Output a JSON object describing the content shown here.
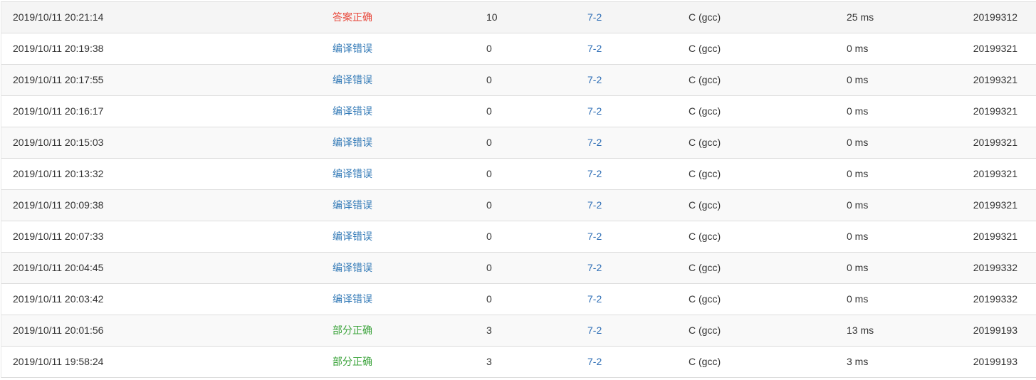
{
  "submissions": [
    {
      "time": "2019/10/11 20:21:14",
      "status": "答案正确",
      "status_type": "ac",
      "score": "10",
      "problem": "7-2",
      "compiler": "C (gcc)",
      "time_used": "25 ms",
      "user": "20199312"
    },
    {
      "time": "2019/10/11 20:19:38",
      "status": "编译错误",
      "status_type": "ce",
      "score": "0",
      "problem": "7-2",
      "compiler": "C (gcc)",
      "time_used": "0 ms",
      "user": "20199321"
    },
    {
      "time": "2019/10/11 20:17:55",
      "status": "编译错误",
      "status_type": "ce",
      "score": "0",
      "problem": "7-2",
      "compiler": "C (gcc)",
      "time_used": "0 ms",
      "user": "20199321"
    },
    {
      "time": "2019/10/11 20:16:17",
      "status": "编译错误",
      "status_type": "ce",
      "score": "0",
      "problem": "7-2",
      "compiler": "C (gcc)",
      "time_used": "0 ms",
      "user": "20199321"
    },
    {
      "time": "2019/10/11 20:15:03",
      "status": "编译错误",
      "status_type": "ce",
      "score": "0",
      "problem": "7-2",
      "compiler": "C (gcc)",
      "time_used": "0 ms",
      "user": "20199321"
    },
    {
      "time": "2019/10/11 20:13:32",
      "status": "编译错误",
      "status_type": "ce",
      "score": "0",
      "problem": "7-2",
      "compiler": "C (gcc)",
      "time_used": "0 ms",
      "user": "20199321"
    },
    {
      "time": "2019/10/11 20:09:38",
      "status": "编译错误",
      "status_type": "ce",
      "score": "0",
      "problem": "7-2",
      "compiler": "C (gcc)",
      "time_used": "0 ms",
      "user": "20199321"
    },
    {
      "time": "2019/10/11 20:07:33",
      "status": "编译错误",
      "status_type": "ce",
      "score": "0",
      "problem": "7-2",
      "compiler": "C (gcc)",
      "time_used": "0 ms",
      "user": "20199321"
    },
    {
      "time": "2019/10/11 20:04:45",
      "status": "编译错误",
      "status_type": "ce",
      "score": "0",
      "problem": "7-2",
      "compiler": "C (gcc)",
      "time_used": "0 ms",
      "user": "20199332"
    },
    {
      "time": "2019/10/11 20:03:42",
      "status": "编译错误",
      "status_type": "ce",
      "score": "0",
      "problem": "7-2",
      "compiler": "C (gcc)",
      "time_used": "0 ms",
      "user": "20199332"
    },
    {
      "time": "2019/10/11 20:01:56",
      "status": "部分正确",
      "status_type": "pa",
      "score": "3",
      "problem": "7-2",
      "compiler": "C (gcc)",
      "time_used": "13 ms",
      "user": "20199193"
    },
    {
      "time": "2019/10/11 19:58:24",
      "status": "部分正确",
      "status_type": "pa",
      "score": "3",
      "problem": "7-2",
      "compiler": "C (gcc)",
      "time_used": "3 ms",
      "user": "20199193"
    }
  ],
  "colors": {
    "accepted": "#e8473a",
    "compile_error": "#337ab7",
    "partial": "#3aa33a",
    "link": "#2d6db5"
  }
}
